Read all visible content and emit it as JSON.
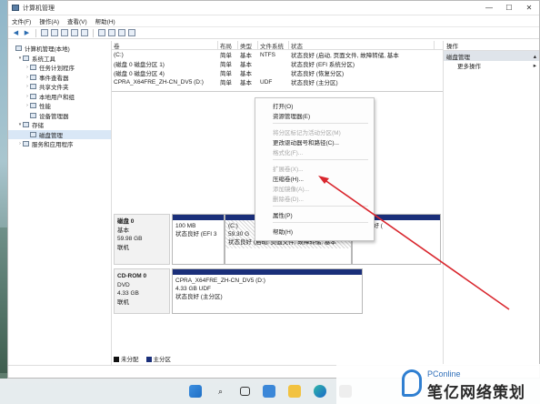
{
  "window": {
    "title": "计算机管理",
    "controls": {
      "minimize": "—",
      "maximize": "☐",
      "close": "✕"
    }
  },
  "menu": [
    "文件(F)",
    "操作(A)",
    "查看(V)",
    "帮助(H)"
  ],
  "tree": [
    {
      "label": "计算机管理(本地)",
      "indent": 0,
      "twisty": ""
    },
    {
      "label": "系统工具",
      "indent": 1,
      "twisty": "▾"
    },
    {
      "label": "任务计划程序",
      "indent": 2,
      "twisty": "›"
    },
    {
      "label": "事件查看器",
      "indent": 2,
      "twisty": "›"
    },
    {
      "label": "共享文件夹",
      "indent": 2,
      "twisty": "›"
    },
    {
      "label": "本地用户和组",
      "indent": 2,
      "twisty": "›"
    },
    {
      "label": "性能",
      "indent": 2,
      "twisty": "›"
    },
    {
      "label": "设备管理器",
      "indent": 2,
      "twisty": ""
    },
    {
      "label": "存储",
      "indent": 1,
      "twisty": "▾"
    },
    {
      "label": "磁盘管理",
      "indent": 2,
      "twisty": "",
      "selected": true
    },
    {
      "label": "服务和应用程序",
      "indent": 1,
      "twisty": "›"
    }
  ],
  "volume_table": {
    "headers": [
      "卷",
      "布局",
      "类型",
      "文件系统",
      "状态"
    ],
    "rows": [
      [
        "(C:)",
        "简单",
        "基本",
        "NTFS",
        "状态良好 (启动, 页面文件, 故障转储, 基本"
      ],
      [
        "(磁盘 0 磁盘分区 1)",
        "简单",
        "基本",
        "",
        "状态良好 (EFI 系统分区)"
      ],
      [
        "(磁盘 0 磁盘分区 4)",
        "简单",
        "基本",
        "",
        "状态良好 (恢复分区)"
      ],
      [
        "CPRA_X64FRE_ZH-CN_DV5 (D:)",
        "简单",
        "基本",
        "UDF",
        "状态良好 (主分区)"
      ]
    ]
  },
  "disks": [
    {
      "name": "磁盘 0",
      "info": [
        "基本",
        "59.98 GB",
        "联机"
      ],
      "partitions": [
        {
          "title": "",
          "size": "100 MB",
          "status": "状态良好 (EFI 3"
        },
        {
          "title": "(C:)",
          "size": "59.30 G",
          "status": "状态良好 (启动, 页面文件, 故障转储, 基本"
        },
        {
          "title": "",
          "size": "",
          "status": "状态良好 ("
        }
      ]
    },
    {
      "name": "CD-ROM 0",
      "info": [
        "DVD",
        "4.33 GB",
        "联机"
      ],
      "partitions": [
        {
          "title": "CPRA_X64FRE_ZH-CN_DV5 (D:)",
          "size": "4.33 GB UDF",
          "status": "状态良好 (主分区)"
        }
      ]
    }
  ],
  "legend": [
    {
      "label": "未分配",
      "color": "#111111"
    },
    {
      "label": "主分区",
      "color": "#1a2f7a"
    }
  ],
  "actions": {
    "header": "操作",
    "section": "磁盘管理",
    "more": "更多操作"
  },
  "context_menu": [
    {
      "label": "打开(O)",
      "enabled": true
    },
    {
      "label": "资源管理器(E)",
      "enabled": true
    },
    {
      "sep": true
    },
    {
      "label": "将分区标记为活动分区(M)",
      "enabled": false
    },
    {
      "label": "更改驱动器号和路径(C)...",
      "enabled": true
    },
    {
      "label": "格式化(F)...",
      "enabled": false
    },
    {
      "sep": true
    },
    {
      "label": "扩展卷(X)...",
      "enabled": false
    },
    {
      "label": "压缩卷(H)...",
      "enabled": true
    },
    {
      "label": "添加镜像(A)...",
      "enabled": false
    },
    {
      "label": "删除卷(D)...",
      "enabled": false
    },
    {
      "sep": true
    },
    {
      "label": "属性(P)",
      "enabled": true
    },
    {
      "sep": true
    },
    {
      "label": "帮助(H)",
      "enabled": true
    }
  ],
  "watermark": {
    "small": "PConline",
    "big": "笔亿网络策划"
  },
  "taskbar_icons": [
    "windows-start-icon",
    "search-icon",
    "task-view-icon",
    "widgets-icon",
    "file-explorer-icon",
    "edge-icon",
    "store-icon"
  ],
  "accent_color": "#d9272e"
}
